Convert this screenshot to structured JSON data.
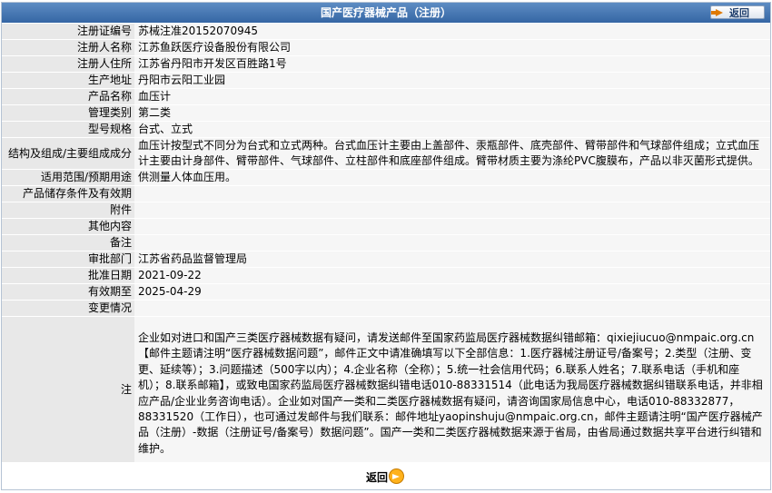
{
  "header": {
    "title": "国产医疗器械产品（注册）",
    "back_label": "返回"
  },
  "fields": [
    {
      "label": "注册证编号",
      "value": "苏械注准20152070945"
    },
    {
      "label": "注册人名称",
      "value": "江苏鱼跃医疗设备股份有限公司"
    },
    {
      "label": "注册人住所",
      "value": "江苏省丹阳市开发区百胜路1号"
    },
    {
      "label": "生产地址",
      "value": "丹阳市云阳工业园"
    },
    {
      "label": "产品名称",
      "value": "血压计"
    },
    {
      "label": "管理类别",
      "value": "第二类"
    },
    {
      "label": "型号规格",
      "value": "台式、立式"
    },
    {
      "label": "结构及组成/主要组成成分",
      "value": "血压计按型式不同分为台式和立式两种。台式血压计主要由上盖部件、汞瓶部件、底壳部件、臂带部件和气球部件组成；立式血压计主要由计身部件、臂带部件、气球部件、立柱部件和底座部件组成。臂带材质主要为涤纶PVC腹膜布，产品以非灭菌形式提供。"
    },
    {
      "label": "适用范围/预期用途",
      "value": "供测量人体血压用。"
    },
    {
      "label": "产品储存条件及有效期",
      "value": ""
    },
    {
      "label": "附件",
      "value": ""
    },
    {
      "label": "其他内容",
      "value": ""
    },
    {
      "label": "备注",
      "value": ""
    },
    {
      "label": "审批部门",
      "value": "江苏省药品监督管理局"
    },
    {
      "label": "批准日期",
      "value": "2021-09-22"
    },
    {
      "label": "有效期至",
      "value": "2025-04-29"
    },
    {
      "label": "变更情况",
      "value": ""
    }
  ],
  "note": {
    "label": "注",
    "text": "企业如对进口和国产三类医疗器械数据有疑问，请发送邮件至国家药监局医疗器械数据纠错邮箱：qixiejiucuo@nmpaic.org.cn【邮件主题请注明“医疗器械数据问题”，邮件正文中请准确填写以下全部信息：1.医疗器械注册证号/备案号；2.类型（注册、变更、延续等）；3.问题描述（500字以内）；4.企业名称（全称）；5.统一社会信用代码；6.联系人姓名；7.联系电话（手机和座机）；8.联系邮箱】，或致电国家药监局医疗器械数据纠错电话010-88331514（此电话为我局医疗器械数据纠错联系电话，并非相应产品/企业业务咨询电话）。企业如对国产一类和二类医疗器械数据有疑问，请咨询国家局信息中心，电话010-88332877，88331520（工作日），也可通过发邮件与我们联系：邮件地址yaopinshuju@nmpaic.org.cn，邮件主题请注明“国产医疗器械产品（注册）-数据（注册证号/备案号）数据问题”。国产一类和二类医疗器械数据来源于省局，由省局通过数据共享平台进行纠错和维护。"
  },
  "footer": {
    "back_label": "返回"
  },
  "colors": {
    "title_bar": "#3566a4",
    "label_bg": "#e8e8e8",
    "value_bg": "#f6f6f6",
    "back_icon": "#ffb21c"
  },
  "icons": {
    "header_back": "arrow-right-icon",
    "footer_back": "circle-arrow-icon"
  }
}
